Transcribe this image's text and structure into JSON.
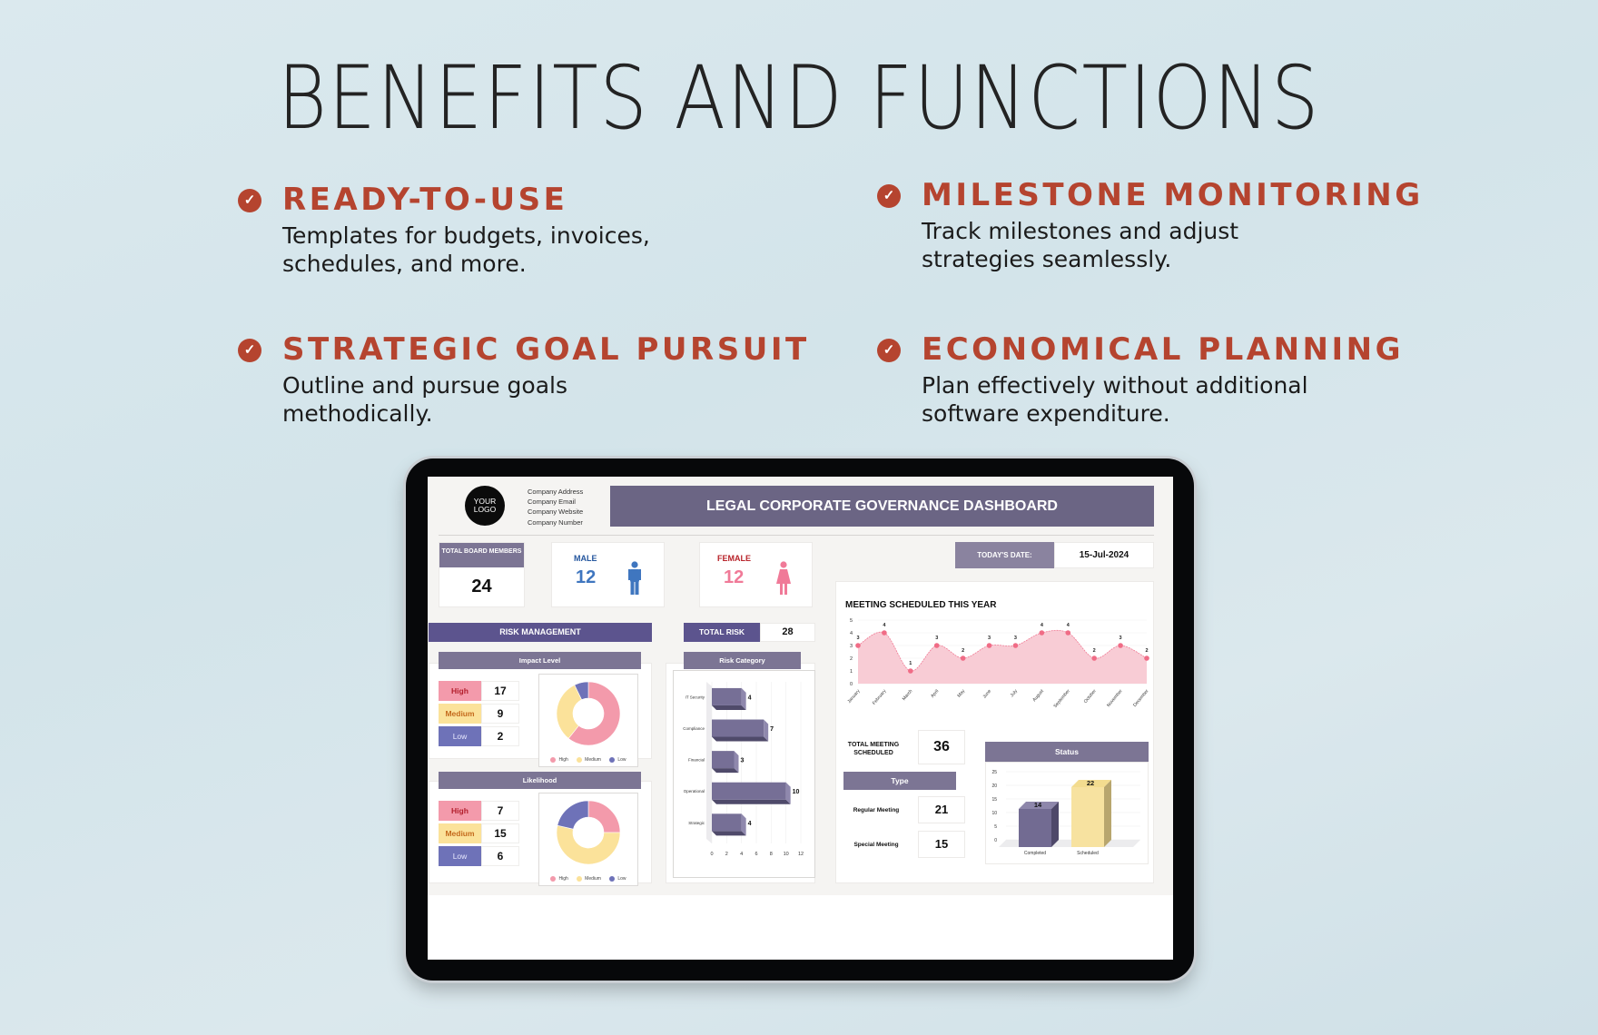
{
  "heading": "BENEFITS AND FUNCTIONS",
  "features": [
    {
      "title": "READY-TO-USE",
      "description": "Templates for budgets, invoices, schedules, and more."
    },
    {
      "title": "MILESTONE MONITORING",
      "description": "Track milestones and adjust strategies seamlessly."
    },
    {
      "title": "STRATEGIC GOAL PURSUIT",
      "description": "Outline and pursue goals methodically."
    },
    {
      "title": "ECONOMICAL PLANNING",
      "description": "Plan effectively without additional software expenditure."
    }
  ],
  "icons": {
    "feature_bullet": "check-circle-icon",
    "male": "male-person-icon",
    "female": "female-person-icon"
  },
  "colors": {
    "accent": "#b5442f",
    "header_purple": "#6b6584",
    "section_purple": "#5c548e",
    "high": "#f39aab",
    "medium": "#fbe29a",
    "low": "#6e72b8",
    "male": "#3f76bf",
    "female": "#f07a98"
  },
  "dashboard": {
    "logo_line1": "YOUR",
    "logo_line2": "LOGO",
    "company": [
      "Company Address",
      "Company Email",
      "Company Website",
      "Company Number"
    ],
    "title": "LEGAL CORPORATE GOVERNANCE DASHBOARD",
    "total_board": {
      "label": "TOTAL BOARD MEMBERS",
      "value": "24"
    },
    "male": {
      "label": "MALE",
      "value": "12"
    },
    "female": {
      "label": "FEMALE",
      "value": "12"
    },
    "today": {
      "label": "TODAY'S DATE:",
      "value": "15-Jul-2024"
    },
    "risk_management": "RISK MANAGEMENT",
    "total_risk": {
      "label": "TOTAL RISK",
      "value": "28"
    },
    "impact": {
      "title": "Impact Level",
      "rows": [
        {
          "label": "High",
          "value": "17"
        },
        {
          "label": "Medium",
          "value": "9"
        },
        {
          "label": "Low",
          "value": "2"
        }
      ]
    },
    "likelihood": {
      "title": "Likelihood",
      "rows": [
        {
          "label": "High",
          "value": "7"
        },
        {
          "label": "Medium",
          "value": "15"
        },
        {
          "label": "Low",
          "value": "6"
        }
      ]
    },
    "risk_category_title": "Risk Category",
    "meetings_title": "MEETING SCHEDULED THIS YEAR",
    "total_meetings": {
      "label": "TOTAL MEETING SCHEDULED",
      "value": "36"
    },
    "type": {
      "title": "Type",
      "rows": [
        {
          "label": "Regular Meeting",
          "value": "21"
        },
        {
          "label": "Special Meeting",
          "value": "15"
        }
      ]
    },
    "status_title": "Status"
  },
  "chart_data": [
    {
      "type": "pie",
      "title": "Impact Level",
      "donut": true,
      "categories": [
        "High",
        "Medium",
        "Low"
      ],
      "values": [
        17,
        9,
        2
      ],
      "colors": [
        "#f39aab",
        "#fbe29a",
        "#6e72b8"
      ],
      "legend": "bottom"
    },
    {
      "type": "pie",
      "title": "Likelihood",
      "donut": true,
      "categories": [
        "High",
        "Medium",
        "Low"
      ],
      "values": [
        7,
        15,
        6
      ],
      "colors": [
        "#f39aab",
        "#fbe29a",
        "#6e72b8"
      ],
      "legend": "bottom"
    },
    {
      "type": "bar",
      "orientation": "horizontal",
      "title": "Risk Category",
      "categories": [
        "IT Security",
        "Compliance",
        "Financial",
        "Operational",
        "Strategic"
      ],
      "values": [
        4,
        7,
        3,
        10,
        4
      ],
      "xlim": [
        0,
        12
      ],
      "xticks": [
        0,
        2,
        4,
        6,
        8,
        10,
        12
      ],
      "color": "#766f96"
    },
    {
      "type": "area",
      "title": "MEETING SCHEDULED THIS YEAR",
      "categories": [
        "January",
        "February",
        "March",
        "April",
        "May",
        "June",
        "July",
        "August",
        "September",
        "October",
        "November",
        "December"
      ],
      "values": [
        3,
        4,
        1,
        3,
        2,
        3,
        3,
        4,
        4,
        2,
        3,
        2
      ],
      "ylim": [
        0,
        5
      ],
      "yticks": [
        0,
        1,
        2,
        3,
        4,
        5
      ],
      "color": "#f06c86",
      "grid": true
    },
    {
      "type": "bar",
      "title": "Status",
      "categories": [
        "Completed",
        "Scheduled"
      ],
      "values": [
        14,
        22
      ],
      "ylim": [
        0,
        25
      ],
      "yticks": [
        0,
        5,
        10,
        15,
        20,
        25
      ],
      "colors": [
        "#726b92",
        "#f7e2a0"
      ]
    }
  ]
}
